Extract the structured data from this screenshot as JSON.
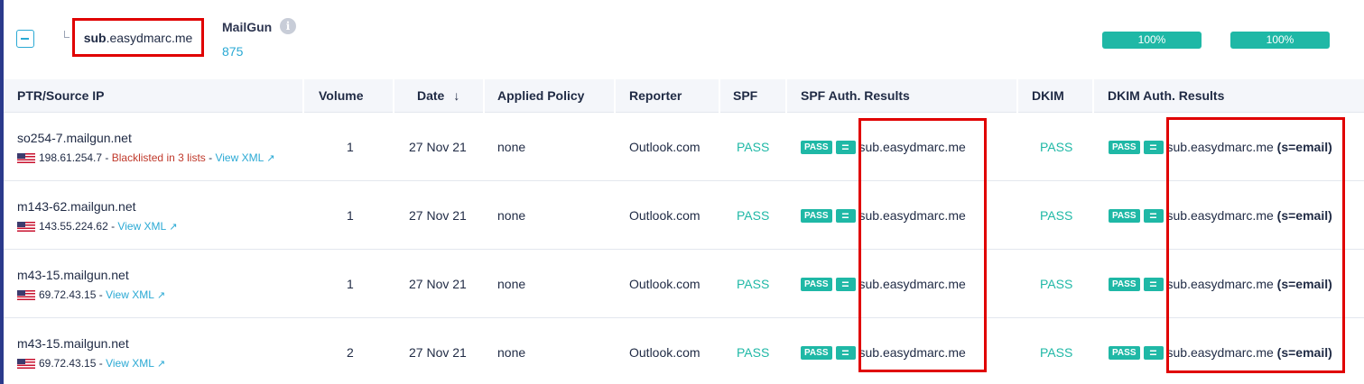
{
  "group": {
    "domain_bold": "sub",
    "domain_rest": ".easydmarc.me",
    "provider": "MailGun",
    "provider_count": "875",
    "info_icon": "i",
    "pct1": "100%",
    "pct2": "100%"
  },
  "headers": {
    "ptr": "PTR/Source IP",
    "volume": "Volume",
    "date": "Date",
    "date_sort_icon": "↓",
    "policy": "Applied Policy",
    "reporter": "Reporter",
    "spf": "SPF",
    "spf_auth": "SPF Auth. Results",
    "dkim": "DKIM",
    "dkim_auth": "DKIM Auth. Results"
  },
  "rows": [
    {
      "ptr": "so254-7.mailgun.net",
      "ip": "198.61.254.7",
      "sep1": " - ",
      "blacklist": "Blacklisted in 3 lists",
      "sep2": " - ",
      "view_xml": "View XML",
      "volume": "1",
      "date": "27 Nov 21",
      "policy": "none",
      "reporter": "Outlook.com",
      "spf": "PASS",
      "spf_badge": "PASS",
      "spf_eq": "=",
      "spf_domain": "sub.easydmarc.me",
      "dkim": "PASS",
      "dkim_badge": "PASS",
      "dkim_eq": "=",
      "dkim_domain": "sub.easydmarc.me",
      "dkim_selector": "(s=email)"
    },
    {
      "ptr": "m143-62.mailgun.net",
      "ip": "143.55.224.62",
      "sep1": " - ",
      "view_xml": "View XML",
      "volume": "1",
      "date": "27 Nov 21",
      "policy": "none",
      "reporter": "Outlook.com",
      "spf": "PASS",
      "spf_badge": "PASS",
      "spf_eq": "=",
      "spf_domain": "sub.easydmarc.me",
      "dkim": "PASS",
      "dkim_badge": "PASS",
      "dkim_eq": "=",
      "dkim_domain": "sub.easydmarc.me",
      "dkim_selector": "(s=email)"
    },
    {
      "ptr": "m43-15.mailgun.net",
      "ip": "69.72.43.15",
      "sep1": " - ",
      "view_xml": "View XML",
      "volume": "1",
      "date": "27 Nov 21",
      "policy": "none",
      "reporter": "Outlook.com",
      "spf": "PASS",
      "spf_badge": "PASS",
      "spf_eq": "=",
      "spf_domain": "sub.easydmarc.me",
      "dkim": "PASS",
      "dkim_badge": "PASS",
      "dkim_eq": "=",
      "dkim_domain": "sub.easydmarc.me",
      "dkim_selector": "(s=email)"
    },
    {
      "ptr": "m43-15.mailgun.net",
      "ip": "69.72.43.15",
      "sep1": " - ",
      "view_xml": "View XML",
      "volume": "2",
      "date": "27 Nov 21",
      "policy": "none",
      "reporter": "Outlook.com",
      "spf": "PASS",
      "spf_badge": "PASS",
      "spf_eq": "=",
      "spf_domain": "sub.easydmarc.me",
      "dkim": "PASS",
      "dkim_badge": "PASS",
      "dkim_eq": "=",
      "dkim_domain": "sub.easydmarc.me",
      "dkim_selector": "(s=email)"
    }
  ],
  "icons": {
    "collapse": "minus-square-icon",
    "info": "info-icon",
    "flag": "us-flag-icon",
    "external": "external-link-icon",
    "sort": "sort-down-icon"
  },
  "colors": {
    "accent": "#1fb8a6",
    "link": "#2aa9d4",
    "warning": "#c0392b",
    "highlight": "#e00000"
  }
}
